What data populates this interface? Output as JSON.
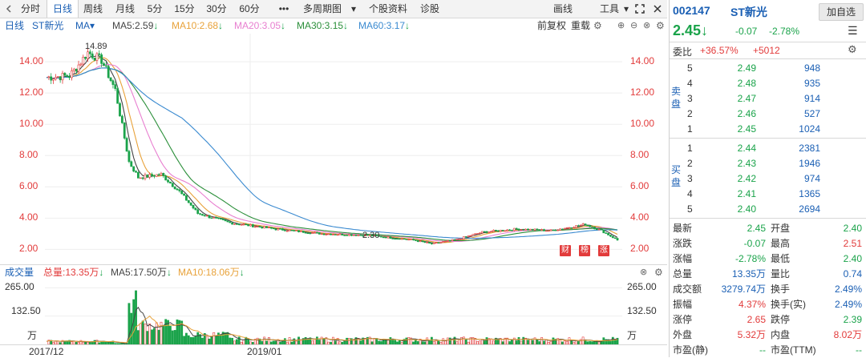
{
  "toolbar": {
    "back_icon": "back-arrow-icon",
    "tabs": [
      "分时",
      "日线",
      "周线",
      "月线",
      "5分",
      "15分",
      "30分",
      "60分",
      "•••",
      "多周期图",
      "▾",
      "个股资料",
      "诊股"
    ],
    "active_tab": "日线",
    "draw_label": "画线",
    "tools_label": "工具",
    "expand_icon": "expand-icon",
    "close_icon": "close-icon"
  },
  "indicators": {
    "period": "日线",
    "name": "ST新光",
    "ma_label": "MA",
    "ma5": "MA5:2.59",
    "ma10": "MA10:2.68",
    "ma20": "MA20:3.05",
    "ma30": "MA30:3.15",
    "ma60": "MA60:3.17",
    "adjust": "前复权",
    "overlay": "重载",
    "colors": {
      "ma5": "#444444",
      "ma10": "#e8a23a",
      "ma20": "#e87fd0",
      "ma30": "#2b8f3a",
      "ma60": "#3a8ad0"
    }
  },
  "price_axis": [
    "14.00",
    "12.00",
    "10.00",
    "8.00",
    "6.00",
    "4.00",
    "2.00"
  ],
  "annotations": {
    "high": "14.89",
    "low": "2.30"
  },
  "tags": [
    "财",
    "榜",
    "涨"
  ],
  "volume": {
    "title": "成交量",
    "total": "总量:13.35万",
    "ma5": "MA5:17.50万",
    "ma10": "MA10:18.06万",
    "axis": [
      "265.00",
      "132.50",
      "万"
    ],
    "close_icon": "close-circle-icon"
  },
  "x_axis": [
    "2017/12",
    "2019/01"
  ],
  "chart_data": {
    "type": "candlestick",
    "title": "ST新光 日线",
    "ylim": [
      2.0,
      15.0
    ],
    "price_path_keypoints": [
      {
        "label": "2017/12",
        "close": 13.0
      },
      {
        "label": "peak",
        "close": 14.89
      },
      {
        "label": "drop",
        "close": 7.0
      },
      {
        "label": "2019/01",
        "close": 3.5
      },
      {
        "label": "low",
        "close": 2.3
      },
      {
        "label": "end",
        "close": 2.45
      }
    ],
    "volume_ylim": [
      0,
      265
    ]
  },
  "quote": {
    "code": "002147",
    "name": "ST新光",
    "add_button": "加自选",
    "price": "2.45",
    "arrow_icon": "down-arrow-icon",
    "change": "-0.07",
    "change_pct": "-2.78%",
    "menu_icon": "list-menu-icon"
  },
  "commission": {
    "label": "委比",
    "ratio": "+36.57%",
    "diff": "+5012",
    "gear_icon": "gear-icon"
  },
  "asks": {
    "label": [
      "卖",
      "盘"
    ],
    "rows": [
      {
        "level": "5",
        "price": "2.49",
        "vol": "948"
      },
      {
        "level": "4",
        "price": "2.48",
        "vol": "935"
      },
      {
        "level": "3",
        "price": "2.47",
        "vol": "914"
      },
      {
        "level": "2",
        "price": "2.46",
        "vol": "527"
      },
      {
        "level": "1",
        "price": "2.45",
        "vol": "1024"
      }
    ]
  },
  "bids": {
    "label": [
      "买",
      "盘"
    ],
    "rows": [
      {
        "level": "1",
        "price": "2.44",
        "vol": "2381"
      },
      {
        "level": "2",
        "price": "2.43",
        "vol": "1946"
      },
      {
        "level": "3",
        "price": "2.42",
        "vol": "974"
      },
      {
        "level": "4",
        "price": "2.41",
        "vol": "1365"
      },
      {
        "level": "5",
        "price": "2.40",
        "vol": "2694"
      }
    ]
  },
  "stats": [
    {
      "l1": "最新",
      "v1": "2.45",
      "l2": "开盘",
      "v2": "2.40"
    },
    {
      "l1": "涨跌",
      "v1": "-0.07",
      "l2": "最高",
      "v2": "2.51"
    },
    {
      "l1": "涨幅",
      "v1": "-2.78%",
      "l2": "最低",
      "v2": "2.40"
    },
    {
      "l1": "总量",
      "v1": "13.35万",
      "l2": "量比",
      "v2": "0.74"
    },
    {
      "l1": "成交额",
      "v1": "3279.74万",
      "l2": "换手",
      "v2": "2.49%"
    },
    {
      "l1": "振幅",
      "v1": "4.37%",
      "l2": "换手(实)",
      "v2": "2.49%"
    },
    {
      "l1": "涨停",
      "v1": "2.65",
      "l2": "跌停",
      "v2": "2.39"
    },
    {
      "l1": "外盘",
      "v1": "5.32万",
      "l2": "内盘",
      "v2": "8.02万"
    },
    {
      "l1": "市盈(静)",
      "v1": "--",
      "l2": "市盈(TTM)",
      "v2": "--"
    }
  ]
}
